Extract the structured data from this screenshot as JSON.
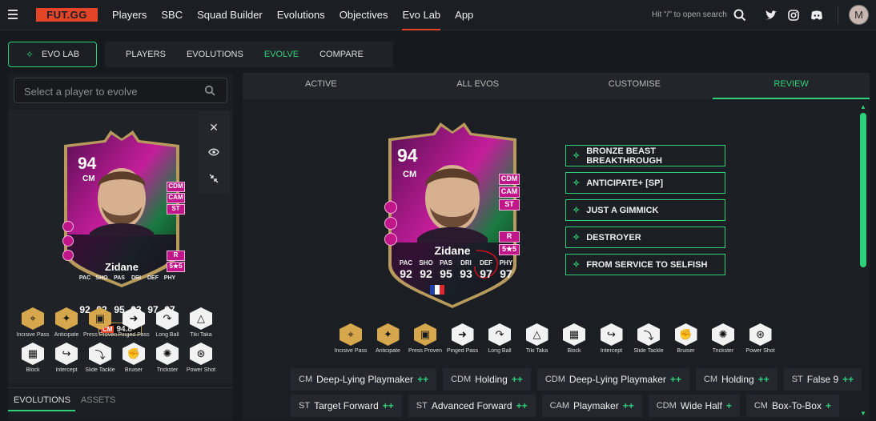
{
  "topbar": {
    "logo": "FUT.GG",
    "nav": [
      "Players",
      "SBC",
      "Squad Builder",
      "Evolutions",
      "Objectives",
      "Evo Lab",
      "App"
    ],
    "search_hint": "Hit \"/\" to open search",
    "avatar_letter": "M"
  },
  "evolab": {
    "button_label": "EVO LAB",
    "subtabs": [
      "PLAYERS",
      "EVOLUTIONS",
      "EVOLVE",
      "COMPARE"
    ]
  },
  "left": {
    "search_placeholder": "Select a player to evolve",
    "bottom_tabs": [
      "EVOLUTIONS",
      "ASSETS"
    ],
    "card": {
      "rating": "94",
      "position": "CM",
      "name": "Zidane",
      "alt_positions": [
        "CDM",
        "CAM",
        "ST"
      ],
      "foot": "R",
      "skills": "5★5",
      "stats": [
        {
          "label": "PAC",
          "value": "92"
        },
        {
          "label": "SHO",
          "value": "92"
        },
        {
          "label": "PAS",
          "value": "95"
        },
        {
          "label": "DRI",
          "value": "93"
        },
        {
          "label": "DEF",
          "value": "97"
        },
        {
          "label": "PHY",
          "value": "97"
        }
      ],
      "chem_pos": "CM",
      "chem_value": "94.8"
    },
    "roles": [
      {
        "label": "Incisive Pass",
        "style": "gold",
        "icon": "pin-icon"
      },
      {
        "label": "Anticipate",
        "style": "gold",
        "icon": "wolf-icon"
      },
      {
        "label": "Press Proven",
        "style": "gold",
        "icon": "screen-icon"
      },
      {
        "label": "Pinged Pass",
        "style": "white",
        "icon": "arrow-icon"
      },
      {
        "label": "Long Ball",
        "style": "white",
        "icon": "curve-icon"
      },
      {
        "label": "Tiki Taka",
        "style": "white",
        "icon": "triangle-icon"
      },
      {
        "label": "Block",
        "style": "white",
        "icon": "block-icon"
      },
      {
        "label": "Intercept",
        "style": "white",
        "icon": "hook-icon"
      },
      {
        "label": "Slide Tackle",
        "style": "white",
        "icon": "slide-icon"
      },
      {
        "label": "Bruiser",
        "style": "white",
        "icon": "arm-icon"
      },
      {
        "label": "Trickster",
        "style": "white",
        "icon": "trick-icon"
      },
      {
        "label": "Power Shot",
        "style": "white",
        "icon": "power-icon"
      }
    ]
  },
  "right": {
    "tabs": [
      "ACTIVE",
      "ALL EVOS",
      "CUSTOMISE",
      "REVIEW"
    ],
    "card": {
      "rating": "94",
      "position": "CM",
      "name": "Zidane",
      "alt_positions": [
        "CDM",
        "CAM",
        "ST"
      ],
      "foot": "R",
      "skills": "5★5",
      "stats": [
        {
          "label": "PAC",
          "value": "92"
        },
        {
          "label": "SHO",
          "value": "92"
        },
        {
          "label": "PAS",
          "value": "95"
        },
        {
          "label": "DRI",
          "value": "93"
        },
        {
          "label": "DEF",
          "value": "97"
        },
        {
          "label": "PHY",
          "value": "97"
        }
      ]
    },
    "evos": [
      "BRONZE BEAST BREAKTHROUGH",
      "ANTICIPATE+ [SP]",
      "JUST A GIMMICK",
      "DESTROYER",
      "FROM SERVICE TO SELFISH"
    ],
    "roles": [
      {
        "label": "Incisive Pass",
        "style": "gold"
      },
      {
        "label": "Anticipate",
        "style": "gold"
      },
      {
        "label": "Press Proven",
        "style": "gold"
      },
      {
        "label": "Pinged Pass",
        "style": "white"
      },
      {
        "label": "Long Ball",
        "style": "white"
      },
      {
        "label": "Tiki Taka",
        "style": "white"
      },
      {
        "label": "Block",
        "style": "white"
      },
      {
        "label": "Intercept",
        "style": "white"
      },
      {
        "label": "Slide Tackle",
        "style": "white"
      },
      {
        "label": "Bruiser",
        "style": "white"
      },
      {
        "label": "Trickster",
        "style": "white"
      },
      {
        "label": "Power Shot",
        "style": "white"
      }
    ],
    "playstyles_row1": [
      {
        "pos": "CM",
        "role": "Deep-Lying Playmaker",
        "plus": "++"
      },
      {
        "pos": "CDM",
        "role": "Holding",
        "plus": "++"
      },
      {
        "pos": "CDM",
        "role": "Deep-Lying Playmaker",
        "plus": "++"
      },
      {
        "pos": "CM",
        "role": "Holding",
        "plus": "++"
      },
      {
        "pos": "ST",
        "role": "False 9",
        "plus": "++"
      }
    ],
    "playstyles_row2": [
      {
        "pos": "ST",
        "role": "Target Forward",
        "plus": "++"
      },
      {
        "pos": "ST",
        "role": "Advanced Forward",
        "plus": "++"
      },
      {
        "pos": "CAM",
        "role": "Playmaker",
        "plus": "++"
      },
      {
        "pos": "CDM",
        "role": "Wide Half",
        "plus": "+"
      },
      {
        "pos": "CM",
        "role": "Box-To-Box",
        "plus": "+"
      }
    ]
  },
  "colors": {
    "accent": "#2fd07a",
    "brand": "#e44528",
    "card_pink": "#c0168a"
  }
}
